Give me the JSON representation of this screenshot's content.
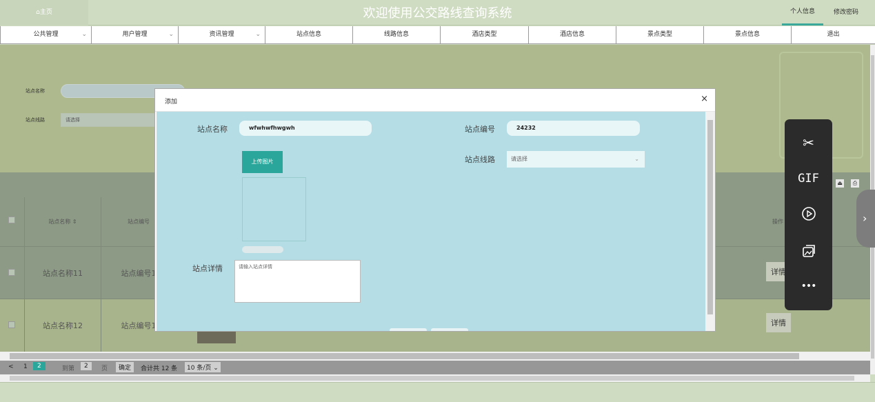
{
  "header": {
    "home": "⌂主页",
    "title": "欢迎使用公交路线查询系统",
    "profile_link": "个人信息",
    "password_link": "修改密码"
  },
  "nav": {
    "items": [
      {
        "label": "公共管理",
        "dropdown": true
      },
      {
        "label": "用户管理",
        "dropdown": true
      },
      {
        "label": "资讯管理",
        "dropdown": true
      },
      {
        "label": "站点信息",
        "dropdown": false
      },
      {
        "label": "线路信息",
        "dropdown": false
      },
      {
        "label": "酒店类型",
        "dropdown": false
      },
      {
        "label": "酒店信息",
        "dropdown": false
      },
      {
        "label": "景点类型",
        "dropdown": false
      },
      {
        "label": "景点信息",
        "dropdown": false
      },
      {
        "label": "退出",
        "dropdown": false
      }
    ]
  },
  "search": {
    "name_label": "站点名称",
    "route_label": "站点线路",
    "route_placeholder": "请选择"
  },
  "table": {
    "headers": {
      "name": "站点名称 ⇕",
      "code": "站点编号",
      "ops": "操作"
    },
    "rows": [
      {
        "name": "站点名称11",
        "code": "站点编号1",
        "detail": "详情"
      },
      {
        "name": "站点名称12",
        "code": "站点编号1",
        "detail": "详情"
      }
    ]
  },
  "pager": {
    "prev": "<",
    "page1": "1",
    "page2": "2",
    "goto": "到第",
    "goto_value": "2",
    "page_unit": "页",
    "confirm": "确定",
    "total": "合计共 12 条",
    "page_size": "10 条/页 ⌄"
  },
  "modal": {
    "title": "添加",
    "close": "×",
    "name_label": "站点名称",
    "name_value": "wfwhwfhwgwh",
    "code_label": "站点编号",
    "code_value": "24232",
    "upload_label": "上传图片",
    "route_label": "站点线路",
    "route_placeholder": "请选择",
    "detail_label": "站点详情",
    "detail_placeholder": "请输入站点详情"
  },
  "toolbar": {
    "items": [
      "scissors-icon",
      "gif-icon",
      "record-icon",
      "gallery-icon",
      "more-icon"
    ],
    "gif_text": "GIF",
    "more_text": "•••"
  },
  "colors": {
    "accent": "#2aa79a",
    "header_bg": "#cfdcc2",
    "modal_body": "#b4dde5"
  }
}
